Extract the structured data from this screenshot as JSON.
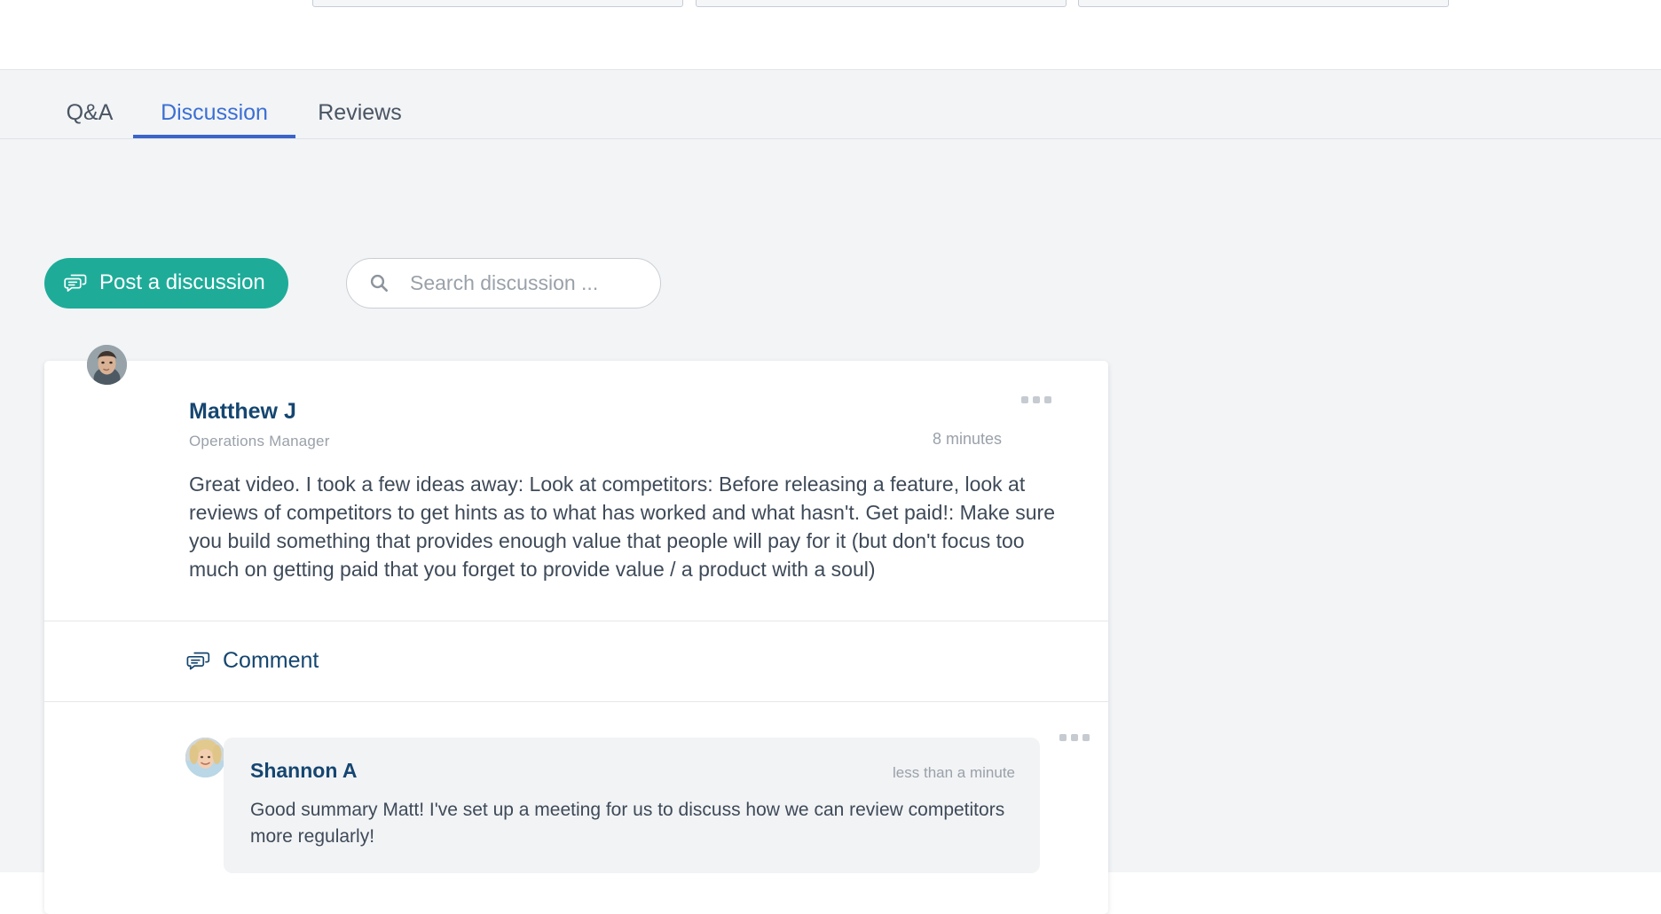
{
  "top_panel": {
    "cards": [
      {
        "name": "stat-card-1"
      },
      {
        "name": "stat-card-2"
      },
      {
        "name": "stat-card-3"
      }
    ]
  },
  "tabs": [
    {
      "id": "qa",
      "label": "Q&A",
      "active": false
    },
    {
      "id": "discussion",
      "label": "Discussion",
      "active": true
    },
    {
      "id": "reviews",
      "label": "Reviews",
      "active": false
    }
  ],
  "actions": {
    "post_button_label": "Post a discussion",
    "post_button_icon": "speech-bubble-icon",
    "search": {
      "placeholder": "Search discussion ...",
      "value": "",
      "icon": "search-icon"
    }
  },
  "discussion": {
    "post": {
      "author": "Matthew J",
      "role": "Operations Manager",
      "timestamp": "8 minutes",
      "avatar_alt": "Matthew J avatar",
      "body": "Great video. I took a few ideas away: Look at competitors: Before releasing a feature, look at reviews of competitors to get hints as to what has worked and what hasn't. Get paid!: Make sure you build something that provides enough value that people will pay for it (but don't focus too much on getting paid that you forget to provide value / a product with a soul)",
      "menu_icon": "ellipsis-icon"
    },
    "comment_action": {
      "label": "Comment",
      "icon": "comment-bubble-icon"
    },
    "reply": {
      "author": "Shannon A",
      "timestamp": "less than a minute",
      "avatar_alt": "Shannon A avatar",
      "body": "Good summary Matt! I've set up a meeting for us to discuss how we can review competitors more regularly!",
      "menu_icon": "ellipsis-icon"
    }
  },
  "colors": {
    "accent_teal": "#1eac99",
    "tab_active_blue": "#3b6fd4",
    "tab_underline": "#3b64c9",
    "author_navy": "#154670",
    "body_text": "#3e4a58",
    "muted_text": "#9aa1a9",
    "page_background": "#f2f4f6",
    "card_background": "#ffffff",
    "reply_bubble_background": "#f2f3f5"
  }
}
